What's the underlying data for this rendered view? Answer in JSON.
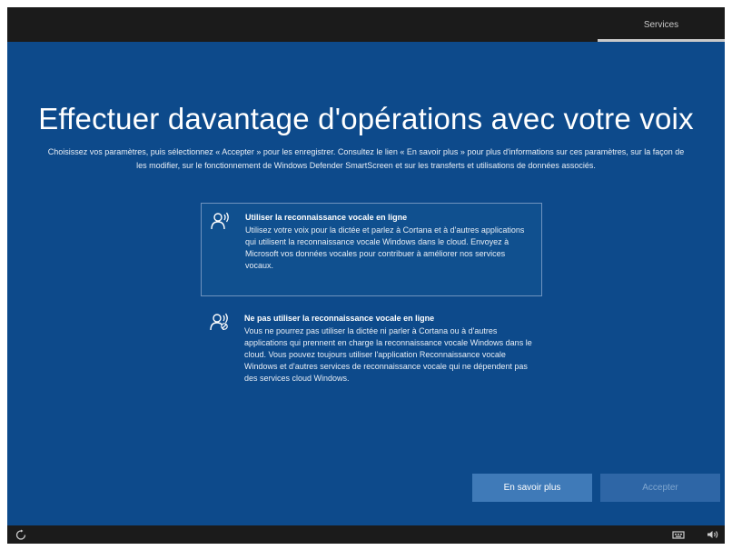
{
  "header": {
    "tab_label": "Services"
  },
  "page": {
    "title": "Effectuer davantage d'opérations avec votre voix",
    "description": "Choisissez vos paramètres, puis sélectionnez « Accepter » pour les enregistrer. Consultez le lien « En savoir plus » pour plus d'informations sur ces paramètres, sur la façon de les modifier, sur le fonctionnement de Windows Defender SmartScreen et sur les transferts et utilisations de données associés."
  },
  "options": [
    {
      "title": "Utiliser la reconnaissance vocale en ligne",
      "body": "Utilisez votre voix pour la dictée et parlez à Cortana et à d'autres applications qui utilisent la reconnaissance vocale Windows dans le cloud. Envoyez à Microsoft vos données vocales pour contribuer à améliorer nos services vocaux.",
      "icon": "speech-online-icon",
      "selected": true
    },
    {
      "title": "Ne pas utiliser la reconnaissance vocale en ligne",
      "body": "Vous ne pourrez pas utiliser la dictée ni parler à Cortana ou à d'autres applications qui prennent en charge la reconnaissance vocale Windows dans le cloud. Vous pouvez toujours utiliser l'application Reconnaissance vocale Windows et d'autres services de reconnaissance vocale qui ne dépendent pas des services cloud Windows.",
      "icon": "speech-offline-icon",
      "selected": false
    }
  ],
  "buttons": {
    "learn_more": "En savoir plus",
    "accept": "Accepter"
  },
  "taskbar": {
    "left_icon": "ease-of-access-icon",
    "right_icons": [
      "keyboard-icon",
      "volume-icon"
    ]
  },
  "colors": {
    "background": "#0d4a8b",
    "chrome": "#1b1b1b",
    "button_primary": "#3f7ab8",
    "button_disabled": "#2e66a6"
  }
}
